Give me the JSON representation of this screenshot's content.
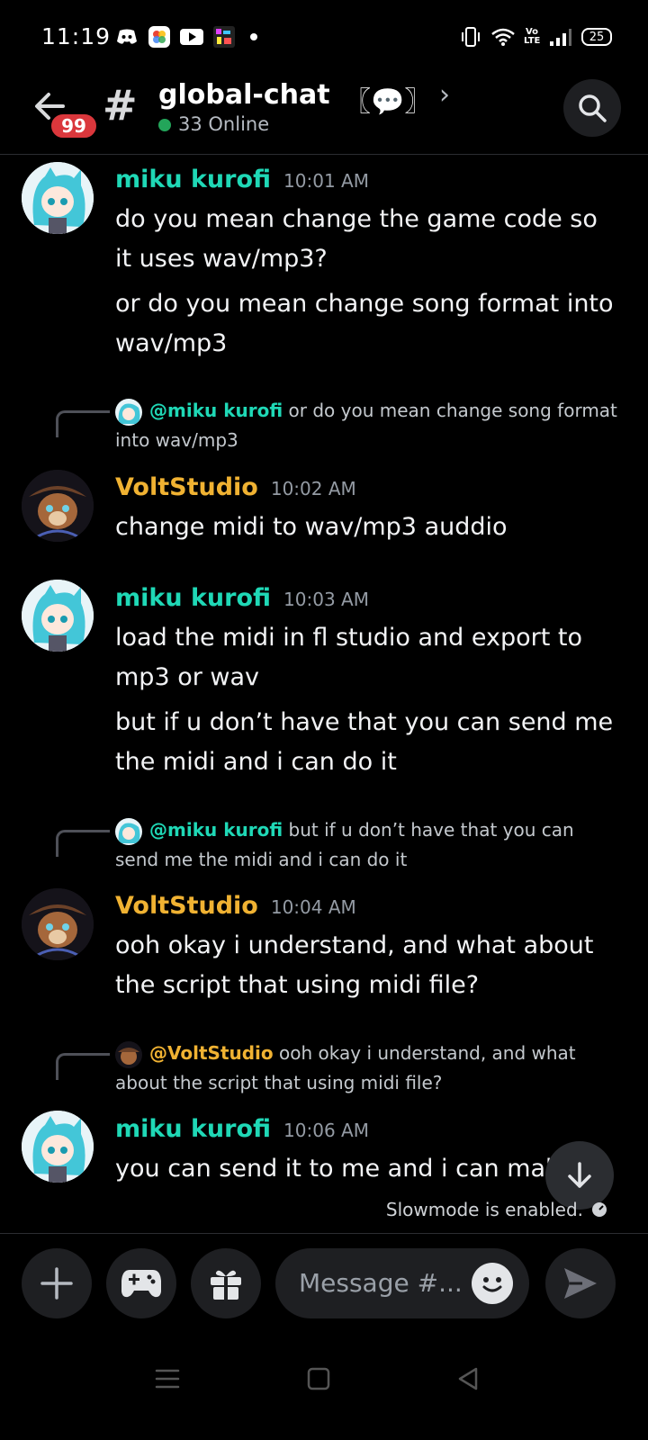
{
  "status_bar": {
    "time": "11:19",
    "network_label": "Vo LTE",
    "battery": "25"
  },
  "header": {
    "notification_count": "99",
    "channel_name": "global-chat",
    "channel_emoji": "〖💬〗",
    "online_count": "33 Online"
  },
  "messages": [
    {
      "author": "miku kurofi",
      "time": "10:01 AM",
      "lines": [
        "do you mean change the game code so it uses wav/mp3?",
        "or do you mean change song format into wav/mp3"
      ]
    },
    {
      "reply_mention": "@miku kurofi",
      "reply_text": "or do you mean change song format into wav/mp3",
      "author": "VoltStudio",
      "time": "10:02 AM",
      "lines": [
        "change midi to wav/mp3 auddio"
      ]
    },
    {
      "author": "miku kurofi",
      "time": "10:03 AM",
      "lines": [
        "load the midi in fl studio and export to mp3 or wav",
        "but if u don’t have that you can send me the midi and i can do it"
      ]
    },
    {
      "reply_mention": "@miku kurofi",
      "reply_text": "but if u don’t have that you can send me the midi and i can do it",
      "author": "VoltStudio",
      "time": "10:04 AM",
      "lines": [
        "ooh okay i understand, and what about the script that using midi file?"
      ]
    },
    {
      "reply_mention": "@VoltStudio",
      "reply_text": "ooh okay i understand, and what about the script that using midi file?",
      "author": "miku kurofi",
      "time": "10:06 AM",
      "lines": [
        "you can send it to me and i can make"
      ]
    }
  ],
  "slowmode": "Slowmode is enabled.",
  "composer": {
    "placeholder": "Message #..."
  },
  "colors": {
    "background": "#000000",
    "miku_name": "#1fd8b6",
    "volt_name": "#f0b232",
    "badge": "#da373c",
    "online": "#23a55a"
  }
}
